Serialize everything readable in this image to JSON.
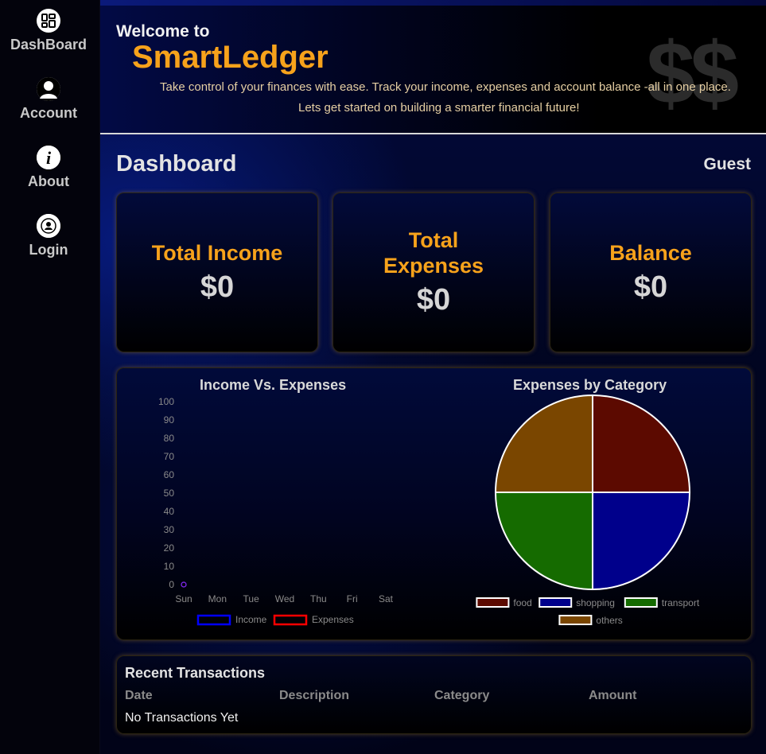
{
  "sidebar": {
    "items": [
      {
        "label": "DashBoard",
        "icon": "dashboard-icon"
      },
      {
        "label": "Account",
        "icon": "user-icon"
      },
      {
        "label": "About",
        "icon": "info-icon"
      },
      {
        "label": "Login",
        "icon": "login-user-icon"
      }
    ]
  },
  "header": {
    "welcome": "Welcome to",
    "brand": "SmartLedger",
    "decor": "$$",
    "tagline1": "Take control of your finances with ease. Track your income, expenses and account balance -all in one place.",
    "tagline2": "Lets get started on building a smarter financial future!"
  },
  "dashboard": {
    "title": "Dashboard",
    "user": "Guest",
    "cards": [
      {
        "title": "Total Income",
        "value": "$0"
      },
      {
        "title": "Total Expenses",
        "value": "$0"
      },
      {
        "title": "Balance",
        "value": "$0"
      }
    ]
  },
  "colors": {
    "accent": "#f7a21b",
    "income": "#0000ff",
    "expenses": "#ff0000"
  },
  "chart_data": [
    {
      "type": "line",
      "title": "Income Vs. Expenses",
      "categories": [
        "Sun",
        "Mon",
        "Tue",
        "Wed",
        "Thu",
        "Fri",
        "Sat"
      ],
      "series": [
        {
          "name": "Income",
          "values": [
            0,
            null,
            null,
            null,
            null,
            null,
            null
          ],
          "color": "#0000ff"
        },
        {
          "name": "Expenses",
          "values": [
            0,
            null,
            null,
            null,
            null,
            null,
            null
          ],
          "color": "#ff0000"
        }
      ],
      "yticks": [
        "0",
        "10",
        "20",
        "30",
        "40",
        "50",
        "60",
        "70",
        "80",
        "90",
        "100"
      ],
      "ylim": [
        0,
        100
      ],
      "legend": "bottom"
    },
    {
      "type": "pie",
      "title": "Expenses by Category",
      "labels": [
        "food",
        "shopping",
        "transport",
        "others"
      ],
      "values": [
        25,
        25,
        25,
        25
      ],
      "colors": [
        "#5c0a00",
        "#00008b",
        "#156b00",
        "#7a4600"
      ],
      "legend": "bottom"
    }
  ],
  "transactions": {
    "title": "Recent Transactions",
    "columns": [
      "Date",
      "Description",
      "Category",
      "Amount"
    ],
    "empty_text": "No Transactions Yet"
  }
}
